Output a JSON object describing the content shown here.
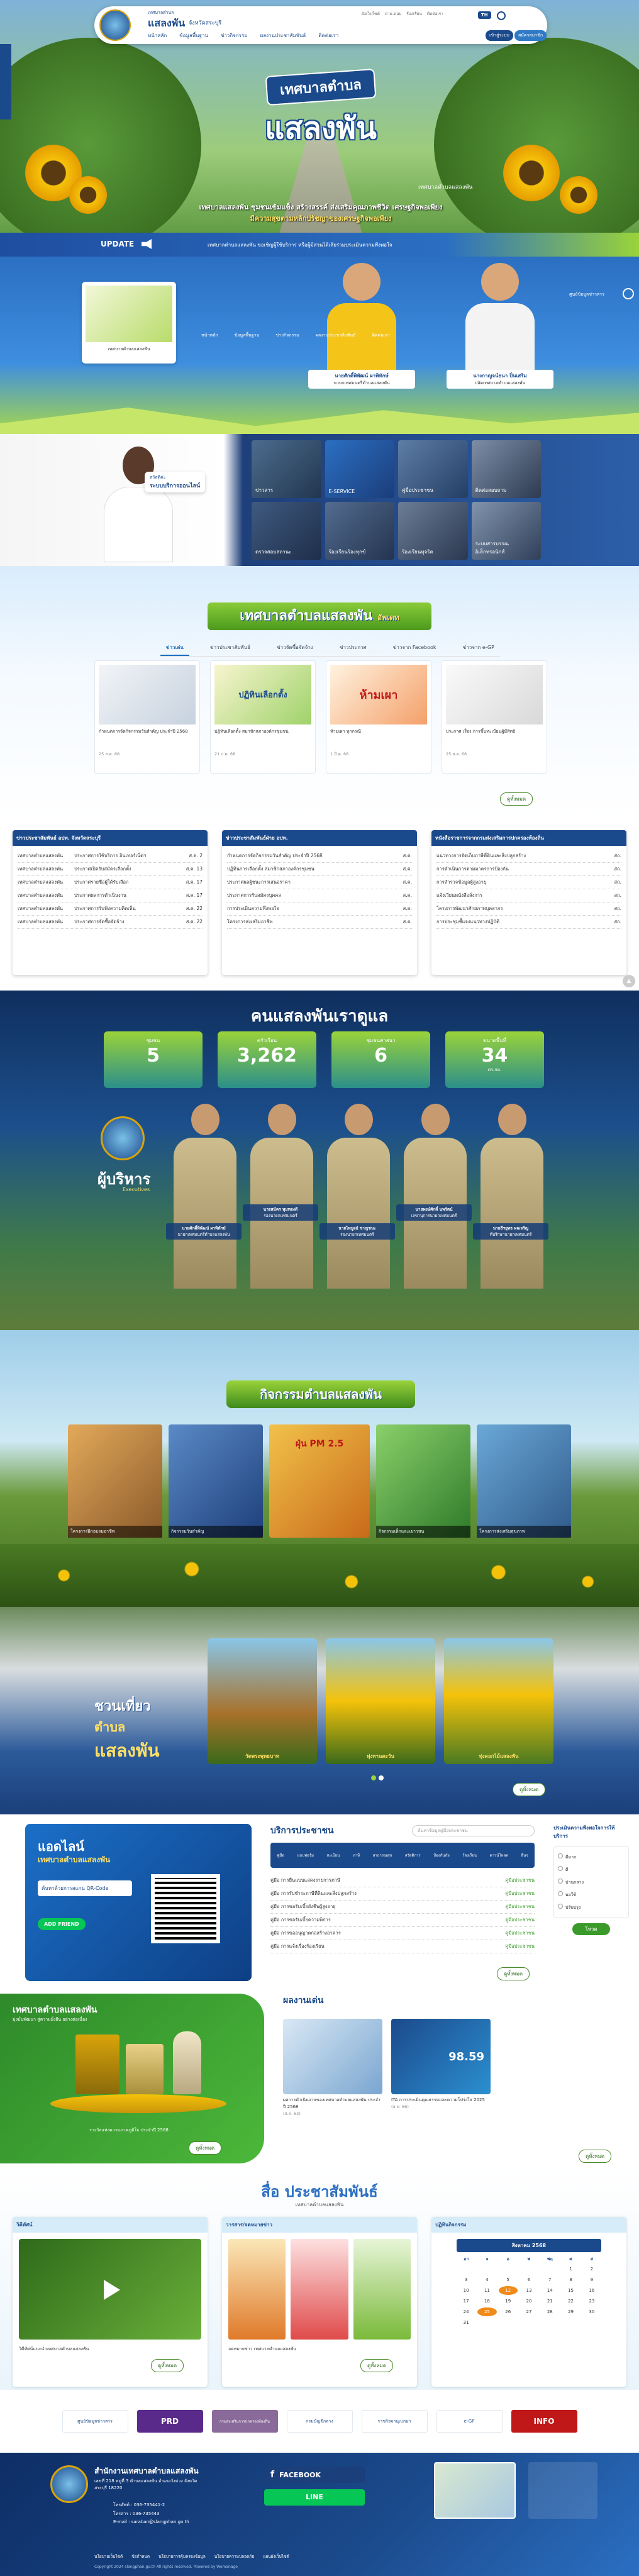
{
  "header": {
    "org_small": "เทศบาลตำบล",
    "org_name": "แสลงพัน",
    "province": "จังหวัดสระบุรี",
    "nav": [
      "หน้าหลัก",
      "ข้อมูลพื้นฐาน",
      "ข่าวกิจกรรม",
      "ผลงานประชาสัมพันธ์",
      "ติดต่อเรา"
    ],
    "login": "เข้าสู่ระบบ",
    "register": "สมัครสมาชิก",
    "lang": "TH",
    "top_links": [
      "ผังเว็บไซต์",
      "ถาม-ตอบ",
      "ร้องเรียน",
      "ติดต่อเรา"
    ]
  },
  "hero": {
    "badge_small": "เทศบาลตำบล",
    "badge_large": "แสลงพัน",
    "overlay_small": "เทศบาลตำบลแสลงพัน",
    "slogan1": "เทศบาลแสลงพัน ชุมชนเข้มแข็ง สร้างสรรค์ ส่งเสริมคุณภาพชีวิต เศรษฐกิจพอเพียง",
    "slogan2": "มีความสุขตามหลักปรัชญาของเศรษฐกิจพอเพียง",
    "update_label": "UPDATE",
    "ticker": "เทศบาลตำบลแสลงพัน ขอเชิญผู้ใช้บริการ หรือผู้มีส่วนได้เสียร่วมประเมินความพึงพอใจ",
    "small_nav": [
      "หน้าหลัก",
      "ข้อมูลพื้นฐาน",
      "ข่าวกิจกรรม",
      "ผลงานประชาสัมพันธ์",
      "ติดต่อเรา"
    ],
    "people": [
      {
        "name": "นายศักดิ์พิพัฒน์ ผาพิทักษ์",
        "role": "นายกเทศมนตรีตำบลแสลงพัน"
      },
      {
        "name": "นางกาญจน์ธนา ปิ่นเสริม",
        "role": "ปลัดเทศบาลตำบลแสลงพัน"
      }
    ],
    "card_caption": "เทศบาลตำบลแสลงพัน",
    "corner": "ศูนย์ข้อมูลข่าวสาร"
  },
  "eservice": {
    "hello": "สวัสดีค่ะ",
    "title": "ระบบบริการออนไลน์",
    "tiles": [
      "ข่าวสาร",
      "E-SERVICE",
      "คู่มือประชาชน",
      "ติดต่อสอบถาม",
      "ตรวจสอบสถานะ",
      "ร้องเรียนร้องทุกข์",
      "ร้องเรียนทุจริต",
      "ระบบสารบรรณอิเล็กทรอนิกส์"
    ]
  },
  "news": {
    "banner": "เทศบาลตำบลแสลงพัน",
    "banner_tag": "อัพเดท",
    "tabs": [
      "ข่าวเด่น",
      "ข่าวประชาสัมพันธ์",
      "ข่าวจัดซื้อจัดจ้าง",
      "ข่าวประกาศ",
      "ข่าวจาก Facebook",
      "ข่าวจาก e-GP"
    ],
    "items": [
      {
        "title": "กำหนดการจัดกิจกรรมวันสำคัญ ประจำปี 2568",
        "date": "25 ส.ค. 68",
        "views": "100"
      },
      {
        "title": "ปฏิทินเลือกตั้ง สมาชิกสภาองค์กรชุมชน",
        "date": "21 ก.ค. 68",
        "views": "100"
      },
      {
        "title": "ห้ามเผา ทุกกรณี",
        "date": "1 มี.ค. 68",
        "views": "100"
      },
      {
        "title": "ประกาศ เรื่อง การขึ้นทะเบียนผู้มีสิทธิ",
        "date": "25 ส.ค. 68",
        "views": "100"
      }
    ],
    "img_texts": [
      "",
      "ปฏิทินเลือกตั้ง",
      "ห้ามเผา",
      ""
    ],
    "more": "ดูทั้งหมด"
  },
  "lists": [
    {
      "title": "ข่าวประชาสัมพันธ์ อปท. จังหวัดสระบุรี",
      "rows": [
        {
          "src": "เทศบาลตำบลแสลงพัน",
          "text": "ประกาศการใช้บริการ อินเทอร์เน็ตฯ",
          "date": "ส.ค. 2"
        },
        {
          "src": "เทศบาลตำบลแสลงพัน",
          "text": "ประกาศเปิดรับสมัครเลือกตั้ง",
          "date": "ส.ค. 13"
        },
        {
          "src": "เทศบาลตำบลแสลงพัน",
          "text": "ประกาศรายชื่อผู้ได้รับเลือก",
          "date": "ส.ค. 17"
        },
        {
          "src": "เทศบาลตำบลแสลงพัน",
          "text": "ประกาศผลการดำเนินงาน",
          "date": "ส.ค. 17"
        },
        {
          "src": "เทศบาลตำบลแสลงพัน",
          "text": "ประกาศการรับฟังความคิดเห็น",
          "date": "ส.ค. 22"
        },
        {
          "src": "เทศบาลตำบลแสลงพัน",
          "text": "ประกาศการจัดซื้อจัดจ้าง",
          "date": "ส.ค. 22"
        }
      ]
    },
    {
      "title": "ข่าวประชาสัมพันธ์ฝ่าย อปท.",
      "rows": [
        {
          "src": "",
          "text": "กำหนดการจัดกิจกรรมวันสำคัญ ประจำปี 2568",
          "date": "ส.ค."
        },
        {
          "src": "",
          "text": "ปฏิทินการเลือกตั้ง สมาชิกสภาองค์กรชุมชน",
          "date": "ส.ค."
        },
        {
          "src": "",
          "text": "ประกาศผลผู้ชนะการเสนอราคา",
          "date": "ส.ค."
        },
        {
          "src": "",
          "text": "ประกาศการรับสมัครบุคคล",
          "date": "ส.ค."
        },
        {
          "src": "",
          "text": "การประเมินความพึงพอใจ",
          "date": "ส.ค."
        },
        {
          "src": "",
          "text": "โครงการส่งเสริมอาชีพ",
          "date": "ส.ค."
        }
      ]
    },
    {
      "title": "หนังสือราชการจากกรมส่งเสริมการปกครองท้องถิ่น",
      "rows": [
        {
          "src": "",
          "text": "แนวทางการจัดเก็บภาษีที่ดินและสิ่งปลูกสร้าง",
          "date": "สถ."
        },
        {
          "src": "",
          "text": "การดำเนินการตามมาตรการป้องกัน",
          "date": "สถ."
        },
        {
          "src": "",
          "text": "การสำรวจข้อมูลผู้สูงอายุ",
          "date": "สถ."
        },
        {
          "src": "",
          "text": "แจ้งเวียนหนังสือสั่งการ",
          "date": "สถ."
        },
        {
          "src": "",
          "text": "โครงการพัฒนาศักยภาพบุคลากร",
          "date": "สถ."
        },
        {
          "src": "",
          "text": "การประชุมชี้แจงแนวทางปฏิบัติ",
          "date": "สถ."
        }
      ]
    }
  ],
  "stats": {
    "title": "คนแสลงพันเราดูแล",
    "items": [
      {
        "label": "ชุมชน",
        "value": "5",
        "unit": ""
      },
      {
        "label": "ครัวเรือน",
        "value": "3,262",
        "unit": ""
      },
      {
        "label": "ชุมชนศาสนา",
        "value": "6",
        "unit": ""
      },
      {
        "label": "ขนาดพื้นที่",
        "value": "34",
        "unit": "ตร.กม."
      }
    ]
  },
  "executives": {
    "title": "ผู้บริหาร",
    "subtitle": "Executives",
    "people": [
      {
        "name": "นายศักดิ์พิพัฒน์ ผาพิทักษ์",
        "role": "นายกเทศมนตรีตำบลแสลงพัน"
      },
      {
        "name": "นายสมัคร ทุมทองดี",
        "role": "รองนายกเทศมนตรี"
      },
      {
        "name": "นายไพบูลย์ ชาญชนะ",
        "role": "รองนายกเทศมนตรี"
      },
      {
        "name": "นายพงษ์ศักดิ์ นพรัตน์",
        "role": "เลขานุการนายกเทศมนตรี"
      },
      {
        "name": "นายธีรยุทธ ผลเจริญ",
        "role": "ที่ปรึกษานายกเทศมนตรี"
      }
    ]
  },
  "activities": {
    "title": "กิจกรรมตำบลแสลงพัน",
    "items": [
      "โครงการฝึกอบรมอาชีพ",
      "กิจกรรมวันสำคัญ",
      "ฝุ่น PM 2.5",
      "กิจกรรมเด็กและเยาวชน",
      "โครงการส่งเสริมสุขภาพ"
    ]
  },
  "tour": {
    "label1": "ชวนเที่ยว",
    "label2": "ตำบล",
    "label3": "แสลงพัน",
    "places": [
      "วัดพระพุทธบาท",
      "ทุ่งทานตะวัน",
      "ทุ่งดอกไม้แสลงพัน"
    ],
    "more": "ดูทั้งหมด"
  },
  "line": {
    "title1": "แอดไลน์",
    "title2": "เทศบาลตำบลแสลงพัน",
    "desc": "ค้นหาด้วยการสแกน QR-Code",
    "add": "ADD FRIEND"
  },
  "services": {
    "title": "บริการประชาชน",
    "search_ph": "ค้นหาข้อมูลคู่มือประชาชน",
    "icons": [
      "คู่มือ",
      "แบบฟอร์ม",
      "ทะเบียน",
      "ภาษี",
      "สาธารณสุข",
      "สวัสดิการ",
      "ป้องกันภัย",
      "ร้องเรียน",
      "ดาวน์โหลด",
      "อื่นๆ"
    ],
    "rows": [
      {
        "text": "คู่มือ การยื่นแบบแสดงรายการภาษี",
        "tag": "คู่มือประชาชน"
      },
      {
        "text": "คู่มือ การรับชำระภาษีที่ดินและสิ่งปลูกสร้าง",
        "tag": "คู่มือประชาชน"
      },
      {
        "text": "คู่มือ การขอรับเบี้ยยังชีพผู้สูงอายุ",
        "tag": "คู่มือประชาชน"
      },
      {
        "text": "คู่มือ การขอรับเบี้ยความพิการ",
        "tag": "คู่มือประชาชน"
      },
      {
        "text": "คู่มือ การขออนุญาตก่อสร้างอาคาร",
        "tag": "คู่มือประชาชน"
      },
      {
        "text": "คู่มือ การแจ้งเรื่องร้องเรียน",
        "tag": "คู่มือประชาชน"
      }
    ],
    "more": "ดูทั้งหมด"
  },
  "poll": {
    "title": "ประเมินความพึงพอใจการให้บริการ",
    "options": [
      "ดีมาก",
      "ดี",
      "ปานกลาง",
      "พอใช้",
      "ปรับปรุง"
    ],
    "vote": "โหวต"
  },
  "awards": {
    "title": "เทศบาลตำบลแสลงพัน",
    "sub": "มุ่งมั่นพัฒนา สู่ความยั่งยืน อย่างต่อเนื่อง",
    "caption": "รางวัลแห่งความภาคภูมิใจ ประจำปี 2568",
    "more": "ดูทั้งหมด"
  },
  "works": {
    "title": "ผลงานเด่น",
    "items": [
      {
        "text": "ผลการดำเนินงานของเทศบาลตำบลแสลงพัน ประจำปี 2568",
        "date": "(ส.ค. 63)"
      },
      {
        "text": "ITA การประเมินคุณธรรมและความโปร่งใส 2025",
        "date": "(ส.ค. 66)"
      }
    ],
    "ita_score": "98.59",
    "more": "ดูทั้งหมด"
  },
  "media": {
    "title": "สื่อ ประชาสัมพันธ์",
    "sub": "เทศบาลตำบลแสลงพัน",
    "cols": [
      {
        "title": "วิดีทัศน์",
        "caption": "วิดีทัศน์แนะนำเทศบาลตำบลแสลงพัน",
        "more": "ดูทั้งหมด"
      },
      {
        "title": "วารสาร/จดหมายข่าว",
        "caption": "จดหมายข่าว เทศบาลตำบลแสลงพัน",
        "more": "ดูทั้งหมด"
      },
      {
        "title": "ปฏิทินกิจกรรม",
        "caption": "",
        "more": ""
      }
    ],
    "calendar": {
      "month": "สิงหาคม 2568",
      "days": [
        "อา",
        "จ",
        "อ",
        "พ",
        "พฤ",
        "ศ",
        "ส"
      ],
      "dates": [
        "",
        "",
        "",
        "",
        "",
        "1",
        "2",
        "3",
        "4",
        "5",
        "6",
        "7",
        "8",
        "9",
        "10",
        "11",
        "12",
        "13",
        "14",
        "15",
        "16",
        "17",
        "18",
        "19",
        "20",
        "21",
        "22",
        "23",
        "24",
        "25",
        "26",
        "27",
        "28",
        "29",
        "30",
        "31"
      ],
      "highlight": [
        "12",
        "25"
      ]
    }
  },
  "partners": [
    "ศูนย์ข้อมูลข่าวสาร",
    "PRD",
    "กรมส่งเสริมการปกครองท้องถิ่น",
    "กรมบัญชีกลาง",
    "ราชกิจจานุเบกษา",
    "e-GP",
    "INFO"
  ],
  "footer": {
    "name": "สำนักงานเทศบาลตำบลแสลงพัน",
    "address": "เลขที่ 218 หมู่ที่ 3 ตำบลแสลงพัน อำเภอวังม่วง จังหวัดสระบุรี 18220",
    "phone": "โทรศัพท์ : 036-735441-2",
    "fax": "โทรสาร : 036-735443",
    "email": "E-mail : saraban@slangphan.go.th",
    "facebook": "FACEBOOK",
    "line_btn": "LINE",
    "links": [
      "นโยบายเว็บไซต์",
      "ข้อกำหนด",
      "นโยบายการคุ้มครองข้อมูล",
      "นโยบายความปลอดภัย",
      "แผนผังเว็บไซต์"
    ],
    "copyright": "Copyright 2024 slangphan.go.th All rights reserved. Powered by Wemanage"
  }
}
